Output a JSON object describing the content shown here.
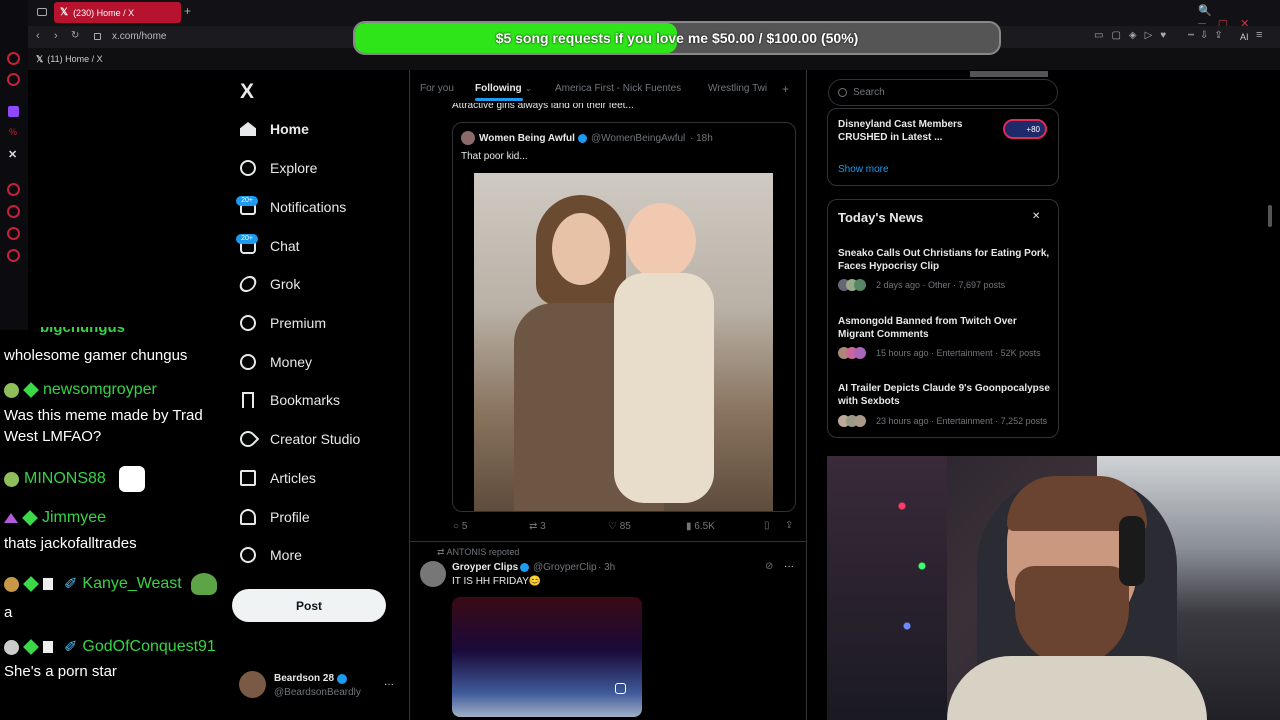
{
  "browser": {
    "tab_title": "(230) Home / X",
    "url": "x.com/home",
    "bookmark_label": "(11) Home / X",
    "ai_label": "AI"
  },
  "donation": {
    "text": "$5 song requests if you love me $50.00 / $100.00 (50%)",
    "progress_percent": 50,
    "fill_color": "#2ee51a"
  },
  "chat": {
    "messages": [
      {
        "user": "",
        "text": "wholesome gamer chungus"
      },
      {
        "user": "newsomgroyper",
        "text": "Was this meme made by Trad West LMFAO?",
        "color": "#36d445"
      },
      {
        "user": "MINONS88",
        "text": "",
        "color": "#36d445"
      },
      {
        "user": "Jimmyee",
        "text": "thats jackofalltrades",
        "color": "#36d445"
      },
      {
        "user": "Kanye_Weast",
        "text": "a",
        "color": "#36d445"
      },
      {
        "user": "GodOfConquest91",
        "text": "She's a porn star",
        "color": "#36d445"
      }
    ]
  },
  "nav": {
    "logo": "X",
    "items": [
      "Home",
      "Explore",
      "Notifications",
      "Chat",
      "Grok",
      "Premium",
      "Money",
      "Bookmarks",
      "Creator Studio",
      "Articles",
      "Profile",
      "More"
    ],
    "notif_badge": "20+",
    "chat_badge": "20+",
    "post_label": "Post",
    "account_name": "Beardson 28",
    "account_handle": "@BeardsonBeardly",
    "account_more": "···"
  },
  "feed": {
    "tabs": [
      "For you",
      "Following",
      "America First - Nick Fuentes",
      "Wrestling Twi"
    ],
    "active_tab": "Following",
    "cut_text": "Attractive girls always land on their feet...",
    "quoted": {
      "author": "Women Being Awful",
      "handle": "@WomenBeingAwful",
      "time": "· 18h",
      "text": "That poor kid..."
    },
    "stats": {
      "replies": "5",
      "reposts": "3",
      "likes": "85",
      "views": "6.5K"
    },
    "next": {
      "repost_line": "ANTONIS repoted",
      "author": "Groyper Clips",
      "handle": "@GroyperClip",
      "time": "· 3h",
      "text": "IT IS HH FRIDAY😊",
      "more": "···"
    }
  },
  "right": {
    "search_placeholder": "Search",
    "trend_title": "Disneyland Cast Members CRUSHED in Latest ...",
    "trend_badge": "+80",
    "show_more": "Show more",
    "news_header": "Today's News",
    "news_close": "✕",
    "news": [
      {
        "title": "Sneako Calls Out Christians for Eating Pork, Faces Hypocrisy Clip",
        "meta": "2 days ago · Other · 7,697 posts"
      },
      {
        "title": "Asmongold Banned from Twitch Over Migrant Comments",
        "meta": "15 hours ago · Entertainment · 52K posts"
      },
      {
        "title": "AI Trailer Depicts Claude 9's Goonpocalypse with Sexbots",
        "meta": "23 hours ago · Entertainment · 7,252 posts"
      }
    ]
  }
}
